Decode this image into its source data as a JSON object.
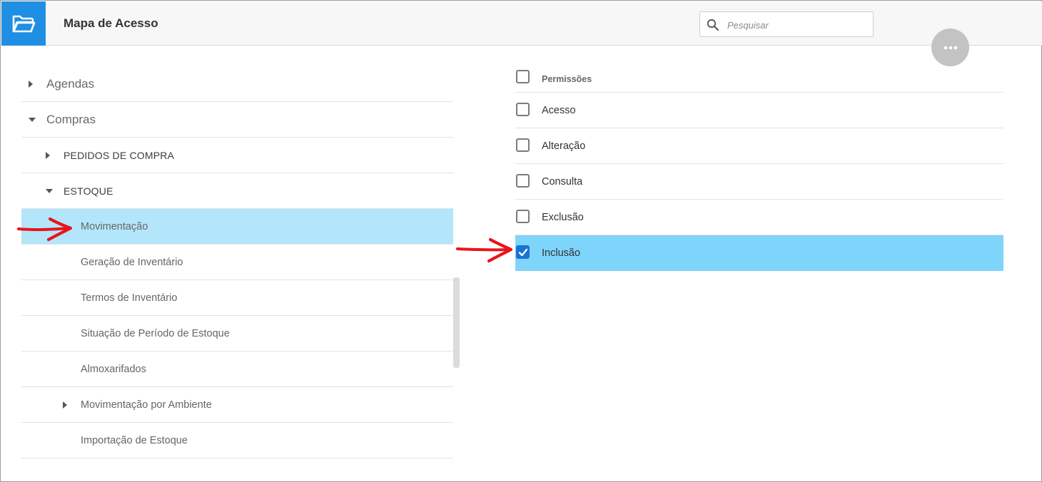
{
  "header": {
    "title": "Mapa de Acesso",
    "app_icon": "folder-open-icon",
    "search_placeholder": "Pesquisar",
    "more_icon": "more-horizontal-icon"
  },
  "colors": {
    "brand": "#1e8fe3",
    "tree_selected": "#b3e6fb",
    "perm_selected": "#7fd4fb",
    "checkbox_checked": "#1873d3",
    "annotation_arrow": "#e8141a"
  },
  "tree": {
    "items": [
      {
        "label": "Agendas",
        "level": 0,
        "expander": "collapsed"
      },
      {
        "label": "Compras",
        "level": 0,
        "expander": "expanded"
      },
      {
        "label": "PEDIDOS DE COMPRA",
        "level": 1,
        "expander": "collapsed"
      },
      {
        "label": "ESTOQUE",
        "level": 1,
        "expander": "expanded"
      },
      {
        "label": "Movimentação",
        "level": 2,
        "expander": "none",
        "selected": true
      },
      {
        "label": "Geração de Inventário",
        "level": 2,
        "expander": "none"
      },
      {
        "label": "Termos de Inventário",
        "level": 2,
        "expander": "none"
      },
      {
        "label": "Situação de Período de Estoque",
        "level": 2,
        "expander": "none"
      },
      {
        "label": "Almoxarifados",
        "level": 2,
        "expander": "none"
      },
      {
        "label": "Movimentação por Ambiente",
        "level": 2,
        "expander": "collapsed"
      },
      {
        "label": "Importação de Estoque",
        "level": 2,
        "expander": "none"
      }
    ]
  },
  "permissions": {
    "header_label": "Permissões",
    "items": [
      {
        "label": "Acesso",
        "checked": false
      },
      {
        "label": "Alteração",
        "checked": false
      },
      {
        "label": "Consulta",
        "checked": false
      },
      {
        "label": "Exclusão",
        "checked": false
      },
      {
        "label": "Inclusão",
        "checked": true,
        "selected": true
      }
    ]
  }
}
